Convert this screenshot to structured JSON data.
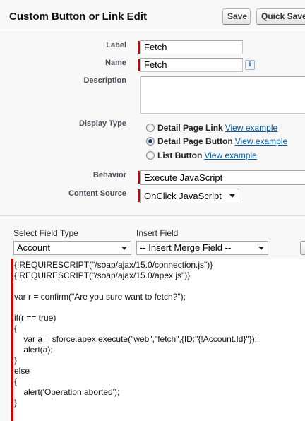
{
  "header": {
    "title": "Custom Button or Link Edit",
    "save_label": "Save",
    "quick_save_label": "Quick Save"
  },
  "form": {
    "label_label": "Label",
    "label_value": "Fetch",
    "name_label": "Name",
    "name_value": "Fetch",
    "info_icon_glyph": "i",
    "description_label": "Description",
    "display_type_label": "Display Type",
    "display_options": [
      {
        "label": "Detail Page Link",
        "link": "View example",
        "checked": false
      },
      {
        "label": "Detail Page Button",
        "link": "View example",
        "checked": true
      },
      {
        "label": "List Button",
        "link": "View example",
        "checked": false
      }
    ],
    "behavior_label": "Behavior",
    "behavior_value": "Execute JavaScript",
    "content_source_label": "Content Source",
    "content_source_value": "OnClick JavaScript"
  },
  "merge": {
    "select_field_type_label": "Select Field Type",
    "select_field_type_value": "Account",
    "insert_field_label": "Insert Field",
    "insert_field_value": "-- Insert Merge Field --"
  },
  "code": {
    "lines": [
      "{!REQUIRESCRIPT(\"/soap/ajax/15.0/connection.js\")}",
      "{!REQUIRESCRIPT(\"/soap/ajax/15.0/apex.js\")}",
      "",
      "var r = confirm(\"Are you sure want to fetch?\");",
      "",
      "if(r == true)",
      "{",
      "    var a = sforce.apex.execute(\"web\",\"fetch\",{ID:\"{!Account.Id}\"});",
      "    alert(a);",
      "}",
      "else",
      "{",
      "    alert('Operation aborted');",
      "}"
    ]
  },
  "colors": {
    "required_bar": "#cc0000",
    "link": "#015ba7"
  }
}
